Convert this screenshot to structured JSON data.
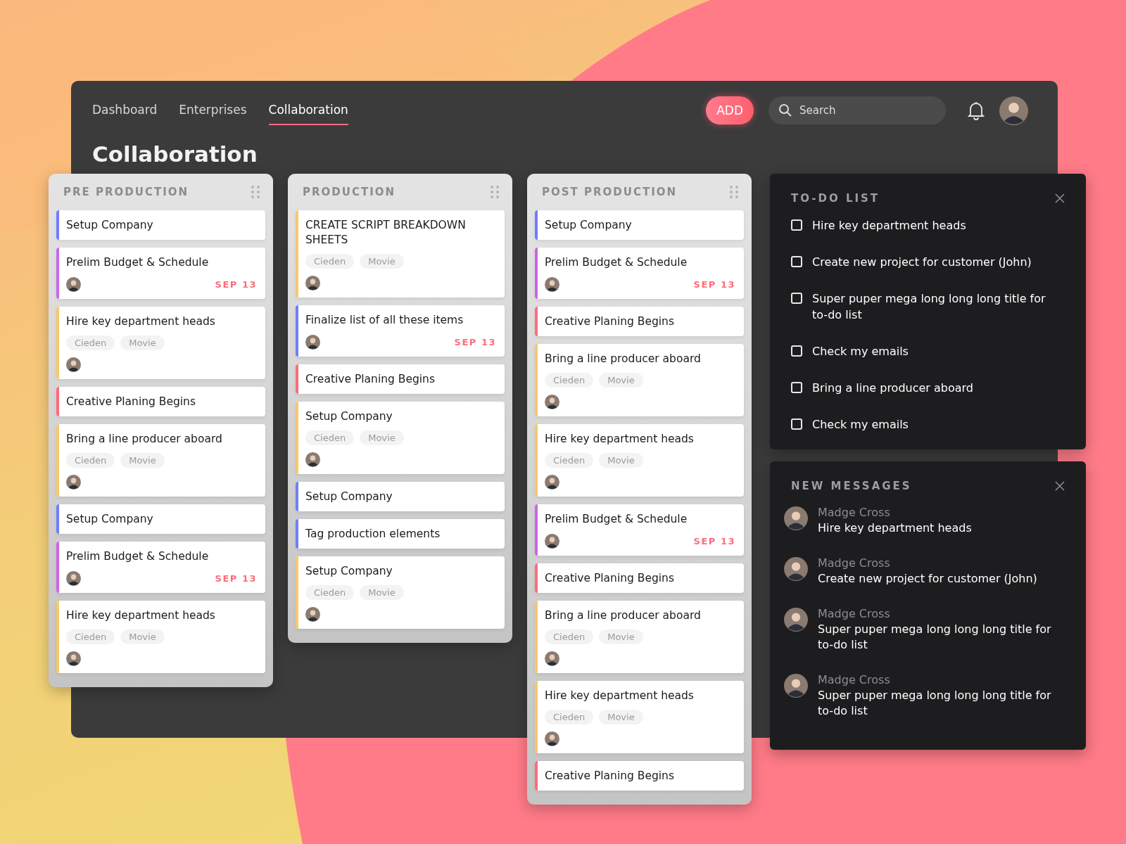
{
  "nav": {
    "tabs": [
      {
        "label": "Dashboard",
        "selected": false
      },
      {
        "label": "Enterprises",
        "selected": false
      },
      {
        "label": "Collaboration",
        "selected": true
      }
    ],
    "add_button": "ADD",
    "search": {
      "placeholder": "Search"
    }
  },
  "title": "Collaboration",
  "columns": [
    {
      "name": "PRE PRODUCTION",
      "cards": [
        {
          "title": "Setup Company",
          "color": "#6f7dff"
        },
        {
          "title": "Prelim Budget & Schedule",
          "color": "#c966e8",
          "avatar": true,
          "date": "SEP 13"
        },
        {
          "title": "Hire key department heads",
          "color": "#f7c86a",
          "tags": [
            "Cieden",
            "Movie"
          ],
          "avatar": true
        },
        {
          "title": "Creative Planing Begins",
          "color": "#ff6b7a"
        },
        {
          "title": "Bring a line producer aboard",
          "color": "#f7c86a",
          "tags": [
            "Cieden",
            "Movie"
          ],
          "avatar": true
        },
        {
          "title": "Setup Company",
          "color": "#6f7dff"
        },
        {
          "title": "Prelim Budget & Schedule",
          "color": "#c966e8",
          "avatar": true,
          "date": "SEP 13"
        },
        {
          "title": "Hire key department heads",
          "color": "#f7c86a",
          "tags": [
            "Cieden",
            "Movie"
          ],
          "avatar": true
        }
      ]
    },
    {
      "name": "PRODUCTION",
      "cards": [
        {
          "title": "CREATE SCRIPT BREAKDOWN SHEETS",
          "color": "#f7c86a",
          "tags": [
            "Cieden",
            "Movie"
          ],
          "avatar": true
        },
        {
          "title": "Finalize list of all these items",
          "color": "#6f7dff",
          "avatar": true,
          "date": "SEP 13"
        },
        {
          "title": "Creative Planing Begins",
          "color": "#ff6b7a"
        },
        {
          "title": "Setup Company",
          "color": "#f7c86a",
          "tags": [
            "Cieden",
            "Movie"
          ],
          "avatar": true
        },
        {
          "title": "Setup Company",
          "color": "#6f7dff"
        },
        {
          "title": "Tag production elements",
          "color": "#6f7dff"
        },
        {
          "title": "Setup Company",
          "color": "#f7c86a",
          "tags": [
            "Cieden",
            "Movie"
          ],
          "avatar": true
        }
      ]
    },
    {
      "name": "POST PRODUCTION",
      "cards": [
        {
          "title": "Setup Company",
          "color": "#6f7dff"
        },
        {
          "title": "Prelim Budget & Schedule",
          "color": "#c966e8",
          "avatar": true,
          "date": "SEP 13"
        },
        {
          "title": "Creative Planing Begins",
          "color": "#ff6b7a"
        },
        {
          "title": "Bring a line producer aboard",
          "color": "#f7c86a",
          "tags": [
            "Cieden",
            "Movie"
          ],
          "avatar": true
        },
        {
          "title": "Hire key department heads",
          "color": "#f7c86a",
          "tags": [
            "Cieden",
            "Movie"
          ],
          "avatar": true
        },
        {
          "title": "Prelim Budget & Schedule",
          "color": "#c966e8",
          "avatar": true,
          "date": "SEP 13"
        },
        {
          "title": "Creative Planing Begins",
          "color": "#ff6b7a"
        },
        {
          "title": "Bring a line producer aboard",
          "color": "#f7c86a",
          "tags": [
            "Cieden",
            "Movie"
          ],
          "avatar": true
        },
        {
          "title": "Hire key department heads",
          "color": "#f7c86a",
          "tags": [
            "Cieden",
            "Movie"
          ],
          "avatar": true
        },
        {
          "title": "Creative Planing Begins",
          "color": "#ff6b7a"
        }
      ]
    }
  ],
  "todo": {
    "title": "TO-DO LIST",
    "items": [
      {
        "label": "Hire key department heads",
        "checked": false
      },
      {
        "label": "Create new project for customer (John)",
        "checked": false
      },
      {
        "label": "Super puper mega long long long title for to-do list",
        "checked": false
      },
      {
        "label": "Check my emails",
        "checked": false
      },
      {
        "label": "Bring a line producer aboard",
        "checked": false
      },
      {
        "label": "Check my emails",
        "checked": false
      }
    ]
  },
  "messages": {
    "title": "NEW MESSAGES",
    "items": [
      {
        "sender": "Madge Cross",
        "text": "Hire key department heads"
      },
      {
        "sender": "Madge Cross",
        "text": "Create new project for customer (John)"
      },
      {
        "sender": "Madge Cross",
        "text": "Super puper mega long long long title for to-do list"
      },
      {
        "sender": "Madge Cross",
        "text": "Super puper mega long long long title for to-do list"
      }
    ]
  }
}
